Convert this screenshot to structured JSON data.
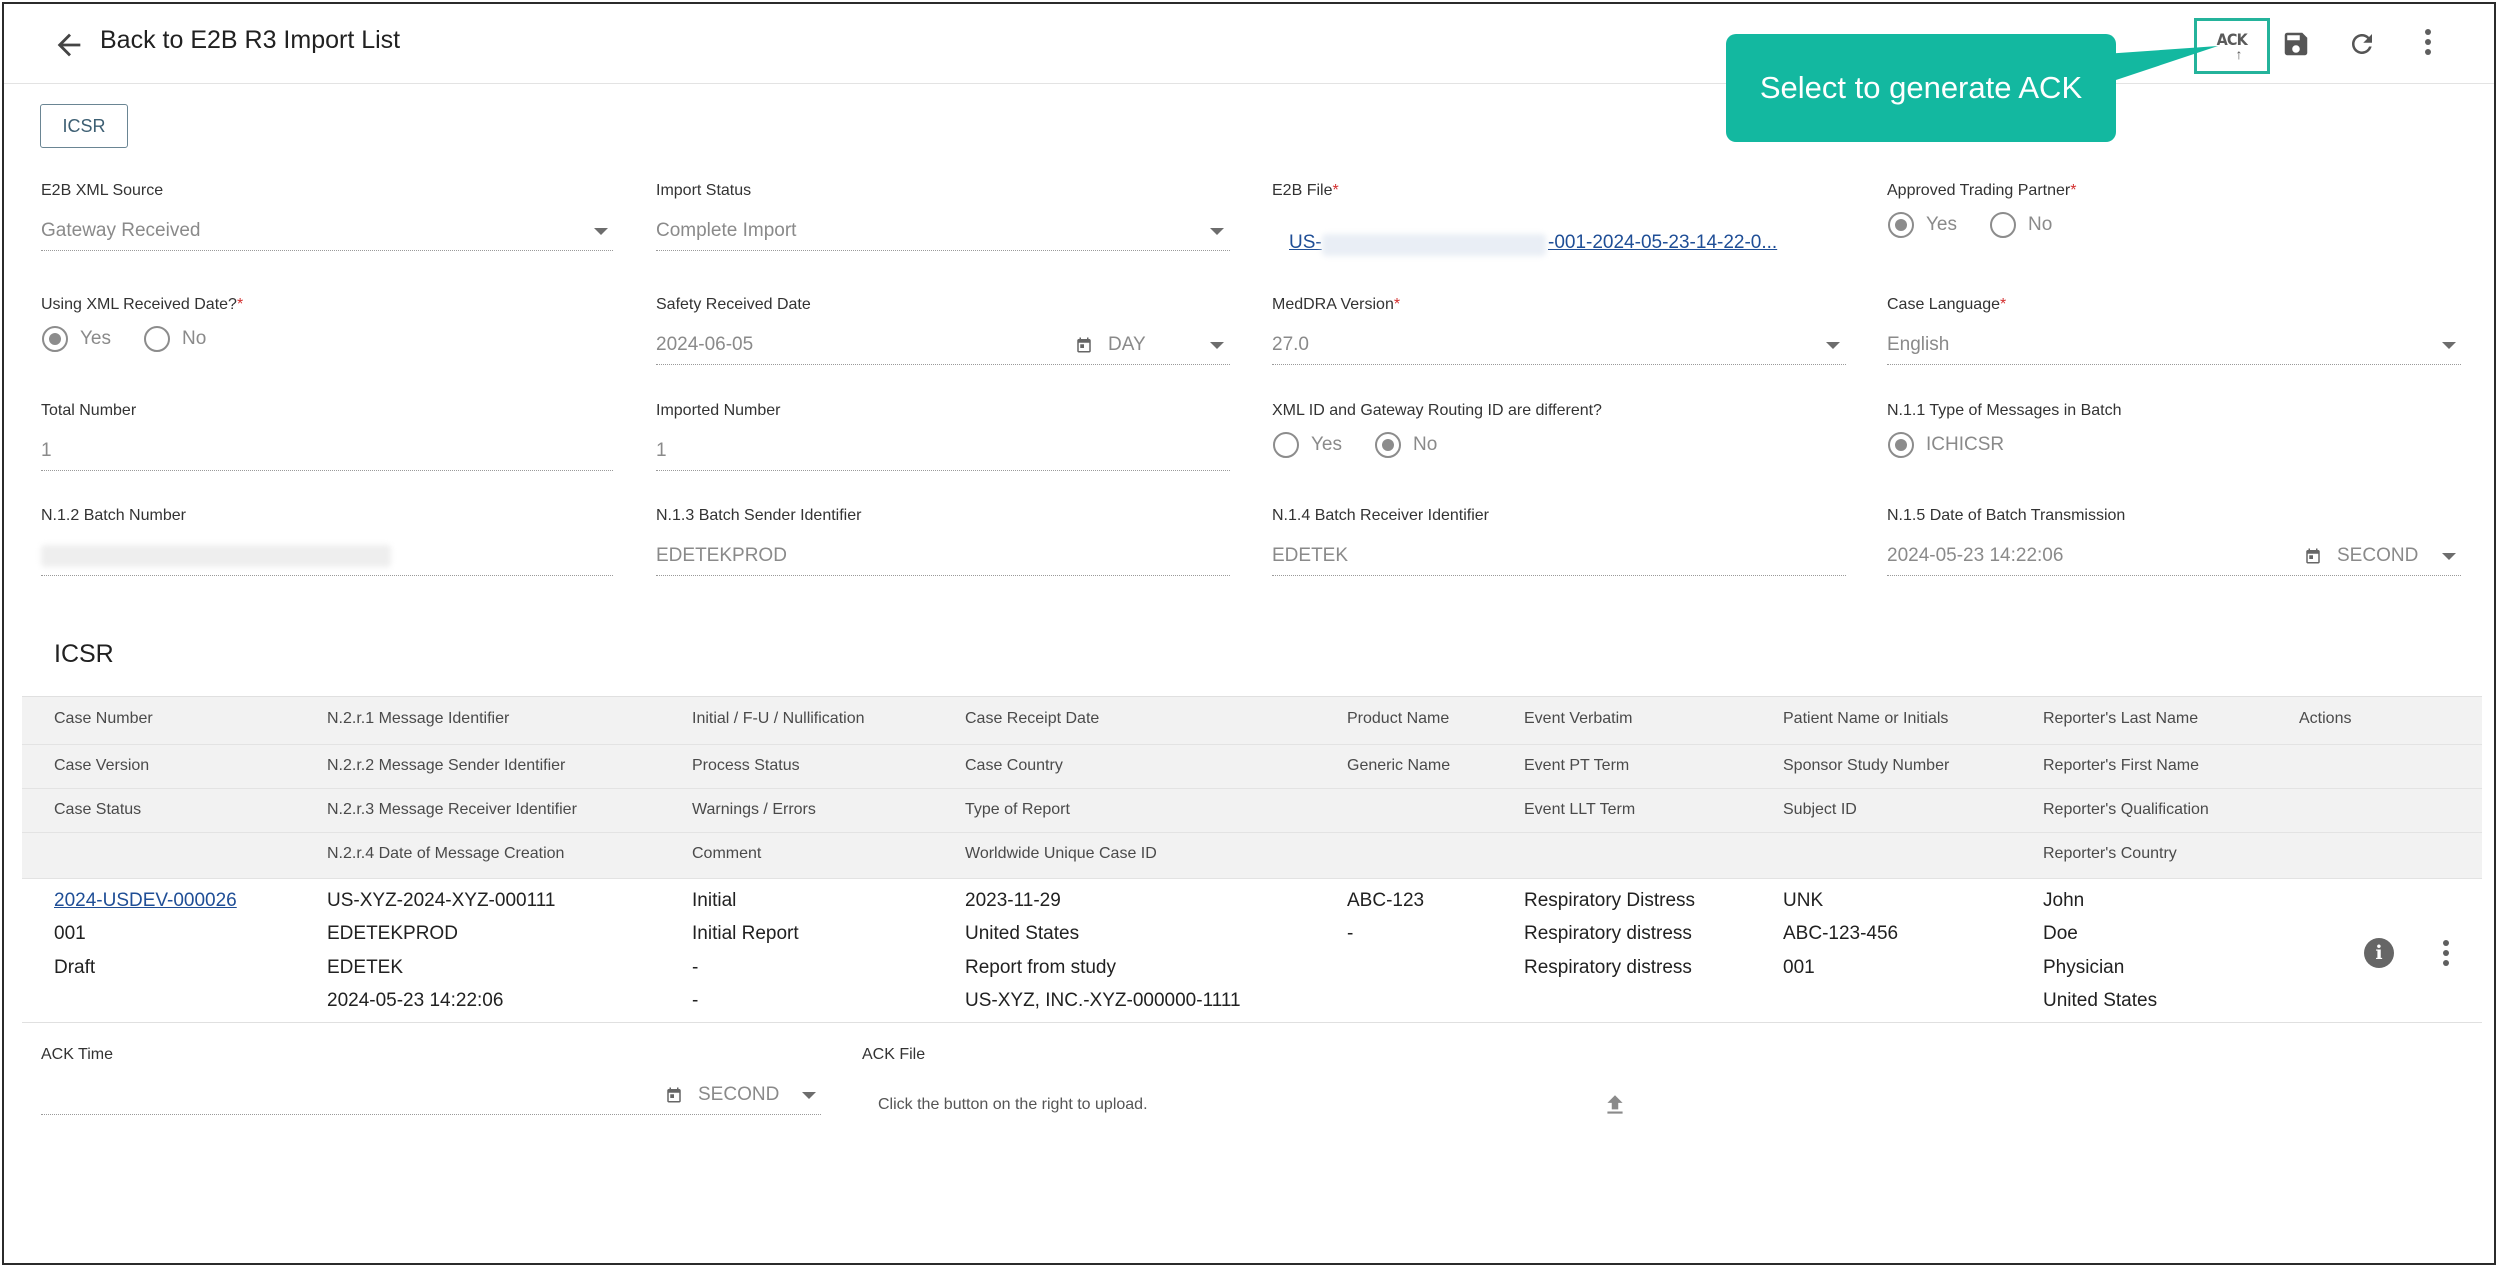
{
  "header": {
    "title": "Back to E2B R3 Import List",
    "ack_label": "ACK",
    "callout": "Select to generate ACK"
  },
  "tabs": [
    "ICSR"
  ],
  "fields": {
    "xml_source": {
      "label": "E2B XML Source",
      "value": "Gateway Received"
    },
    "import_status": {
      "label": "Import Status",
      "value": "Complete Import"
    },
    "e2b_file": {
      "label": "E2B File",
      "value_start": "US-",
      "value_end": "-001-2024-05-23-14-22-0..."
    },
    "approved_partner": {
      "label": "Approved Trading Partner",
      "options": [
        "Yes",
        "No"
      ],
      "selected": "Yes"
    },
    "using_xml_date": {
      "label": "Using XML Received Date?",
      "options": [
        "Yes",
        "No"
      ],
      "selected": "Yes"
    },
    "safety_received_date": {
      "label": "Safety Received Date",
      "value": "2024-06-05",
      "unit": "DAY"
    },
    "meddra_version": {
      "label": "MedDRA Version",
      "value": "27.0"
    },
    "case_language": {
      "label": "Case Language",
      "value": "English"
    },
    "total_number": {
      "label": "Total Number",
      "value": "1"
    },
    "imported_number": {
      "label": "Imported Number",
      "value": "1"
    },
    "xml_id_diff": {
      "label": "XML ID and Gateway Routing ID are different?",
      "options": [
        "Yes",
        "No"
      ],
      "selected": "No"
    },
    "n11_type": {
      "label": "N.1.1 Type of Messages in Batch",
      "option": "ICHICSR"
    },
    "n12_batch_number": {
      "label": "N.1.2 Batch Number"
    },
    "n13_sender": {
      "label": "N.1.3 Batch Sender Identifier",
      "value": "EDETEKPROD"
    },
    "n14_receiver": {
      "label": "N.1.4 Batch Receiver Identifier",
      "value": "EDETEK"
    },
    "n15_date": {
      "label": "N.1.5 Date of Batch Transmission",
      "value": "2024-05-23 14:22:06",
      "unit": "SECOND"
    }
  },
  "icsr": {
    "title": "ICSR",
    "header_rows": [
      [
        "Case Number",
        "N.2.r.1 Message Identifier",
        "Initial / F-U / Nullification",
        "Case Receipt Date",
        "Product Name",
        "Event Verbatim",
        "Patient Name or Initials",
        "Reporter's Last Name",
        "Actions"
      ],
      [
        "Case Version",
        "N.2.r.2 Message Sender Identifier",
        "Process Status",
        "Case Country",
        "Generic Name",
        "Event PT Term",
        "Sponsor Study Number",
        "Reporter's First Name",
        ""
      ],
      [
        "Case Status",
        "N.2.r.3 Message Receiver Identifier",
        "Warnings / Errors",
        "Type of Report",
        "",
        "Event LLT Term",
        "Subject ID",
        "Reporter's Qualification",
        ""
      ],
      [
        "",
        "N.2.r.4 Date of Message Creation",
        "Comment",
        "Worldwide Unique Case ID",
        "",
        "",
        "",
        "Reporter's Country",
        ""
      ]
    ],
    "data_rows": [
      [
        "2024-USDEV-000026",
        "US-XYZ-2024-XYZ-000111",
        "Initial",
        "2023-11-29",
        "ABC-123",
        "Respiratory Distress",
        "UNK",
        "John"
      ],
      [
        "001",
        "EDETEKPROD",
        "Initial Report",
        "United States",
        "-",
        "Respiratory distress",
        "ABC-123-456",
        "Doe"
      ],
      [
        "Draft",
        "EDETEK",
        "-",
        "Report from study",
        "",
        "Respiratory distress",
        "001",
        "Physician"
      ],
      [
        "",
        "2024-05-23 14:22:06",
        "-",
        "US-XYZ, INC.-XYZ-000000-1111",
        "",
        "",
        "",
        "United States"
      ]
    ]
  },
  "ack": {
    "time_label": "ACK Time",
    "time_unit": "SECOND",
    "file_label": "ACK File",
    "upload_hint": "Click the button on the right to upload."
  },
  "colors": {
    "accent": "#13b8a0",
    "link": "#1f4e96",
    "required": "#d32f2f"
  }
}
